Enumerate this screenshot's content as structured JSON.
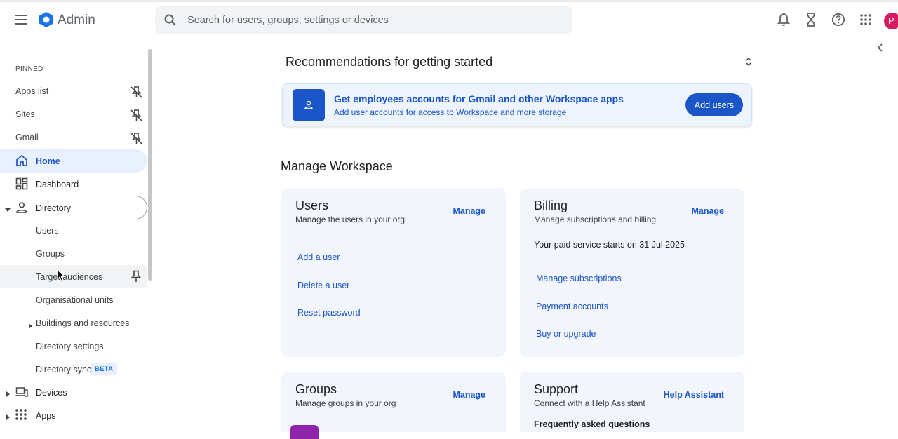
{
  "header": {
    "app_title": "Admin",
    "search_placeholder": "Search for users, groups, settings or devices",
    "avatar_initial": "P",
    "icons": [
      "menu-icon",
      "admin-logo-icon",
      "search-icon",
      "bell-icon",
      "hourglass-icon",
      "help-icon",
      "apps-grid-icon"
    ]
  },
  "sidebar": {
    "pinned_label": "PINNED",
    "pinned": [
      {
        "label": "Apps list"
      },
      {
        "label": "Sites"
      },
      {
        "label": "Gmail"
      }
    ],
    "nav": {
      "home": "Home",
      "dashboard": "Dashboard",
      "directory": "Directory",
      "devices": "Devices",
      "apps": "Apps"
    },
    "directory_items": {
      "users": "Users",
      "groups": "Groups",
      "target_audiences": "Target audiences",
      "org_units": "Organisational units",
      "buildings": "Buildings and resources",
      "dir_settings": "Directory settings",
      "dir_sync": "Directory sync",
      "beta": "BETA"
    }
  },
  "recommendations": {
    "title": "Recommendations for getting started",
    "card_heading": "Get employees accounts for Gmail and other Workspace apps",
    "card_sub": "Add user accounts for access to Workspace and more storage",
    "button": "Add users"
  },
  "manage": {
    "title": "Manage Workspace",
    "users": {
      "title": "Users",
      "subtitle": "Manage the users in your org",
      "action": "Manage",
      "links": [
        "Add a user",
        "Delete a user",
        "Reset password"
      ]
    },
    "billing": {
      "title": "Billing",
      "subtitle": "Manage subscriptions and billing",
      "action": "Manage",
      "note": "Your paid service starts on 31 Jul 2025",
      "links": [
        "Manage subscriptions",
        "Payment accounts",
        "Buy or upgrade"
      ]
    },
    "groups": {
      "title": "Groups",
      "subtitle": "Manage groups in your org",
      "action": "Manage"
    },
    "support": {
      "title": "Support",
      "subtitle": "Connect with a Help Assistant",
      "action": "Help Assistant",
      "faq": "Frequently asked questions"
    }
  },
  "colors": {
    "accent": "#1a56c8",
    "active_bg": "#e8f0fe",
    "card_bg": "#f2f5fb",
    "avatar": "#d81b60"
  }
}
